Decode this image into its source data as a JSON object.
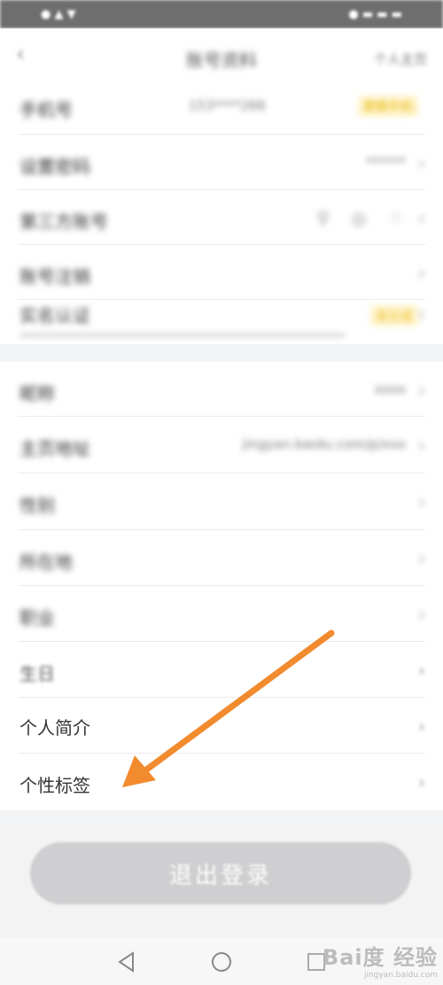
{
  "status_bar": {
    "left": "● ▲ ▼",
    "right": "● ▬ ▬ ▬"
  },
  "nav": {
    "back_icon": "chevron-left-icon",
    "title": "账号资料",
    "right": "个人主页"
  },
  "group1": [
    {
      "label": "手机号",
      "value": "153****266",
      "badge": "更换手机"
    },
    {
      "label": "设置密码",
      "value": "******"
    },
    {
      "label": "第三方账号",
      "value": ""
    },
    {
      "label": "账号注销",
      "value": ""
    },
    {
      "label": "实名认证",
      "value": "",
      "badge": "去认证"
    }
  ],
  "group2": [
    {
      "label": "昵称",
      "value": "xxxx"
    },
    {
      "label": "主页地址",
      "value": "jingyan.baidu.com/p/xxx"
    },
    {
      "label": "性别",
      "value": ""
    },
    {
      "label": "所在地",
      "value": ""
    },
    {
      "label": "职业",
      "value": ""
    },
    {
      "label": "生日",
      "value": ""
    },
    {
      "label": "个人简介",
      "value": ""
    },
    {
      "label": "个性标签",
      "value": ""
    }
  ],
  "logout": {
    "label": "退出登录"
  },
  "bottom_nav": {
    "back": "triangle-back-icon",
    "home": "circle-home-icon",
    "recent": "square-recent-icon"
  },
  "watermark": {
    "brand": "Bai度 经验",
    "url": "jingyan.baidu.com"
  },
  "colors": {
    "accent_arrow": "#f28a2e",
    "badge": "#e7b400"
  }
}
